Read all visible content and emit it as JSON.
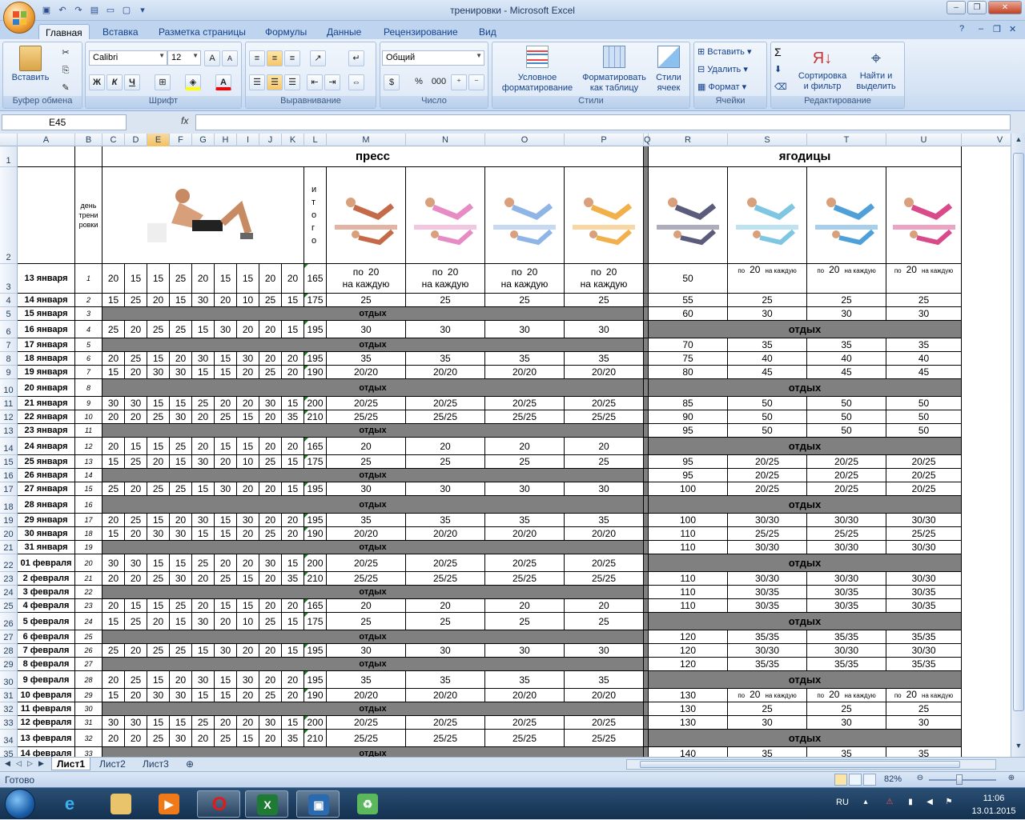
{
  "window": {
    "title": "тренировки - Microsoft Excel"
  },
  "ribbon": {
    "tabs": [
      "Главная",
      "Вставка",
      "Разметка страницы",
      "Формулы",
      "Данные",
      "Рецензирование",
      "Вид"
    ],
    "clipboard": {
      "paste": "Вставить",
      "group": "Буфер обмена"
    },
    "font": {
      "name": "Calibri",
      "size": "12",
      "bold": "Ж",
      "italic": "К",
      "underline": "Ч",
      "group": "Шрифт"
    },
    "alignment": {
      "group": "Выравнивание"
    },
    "number": {
      "format": "Общий",
      "percent": "%",
      "thousands": "000",
      "group": "Число"
    },
    "styles": {
      "cond_format": "Условное форматирование",
      "as_table": "Форматировать как таблицу",
      "cell_styles": "Стили ячеек",
      "group": "Стили"
    },
    "cells": {
      "insert": "Вставить",
      "delete": "Удалить",
      "format": "Формат",
      "group": "Ячейки"
    },
    "editing": {
      "sum": "Σ",
      "sort": "Сортировка и фильтр",
      "find": "Найти и выделить",
      "group": "Редактирование"
    }
  },
  "formula_bar": {
    "name_box": "E45",
    "fx": "fx",
    "formula": ""
  },
  "columns": [
    "A",
    "B",
    "C",
    "D",
    "E",
    "F",
    "G",
    "H",
    "I",
    "J",
    "K",
    "L",
    "M",
    "N",
    "O",
    "P",
    "Q",
    "R",
    "S",
    "T",
    "U",
    "V"
  ],
  "selected_column": "E",
  "sheet": {
    "header": {
      "press": "пресс",
      "glutes": "ягодицы",
      "day_label": "день трени ровки",
      "itogo": "и т о г о"
    },
    "rest": "отдых",
    "po": "по",
    "twenty": "20",
    "na_kazhduyu": "на каждую",
    "rows": [
      {
        "date": "13 января",
        "day": "1",
        "reps": [
          "20",
          "15",
          "15",
          "25",
          "20",
          "15",
          "15",
          "20",
          "20"
        ],
        "total": "165",
        "press": "mixed",
        "glutes": {
          "r": "50",
          "stu": "mixed"
        }
      },
      {
        "date": "14 января",
        "day": "2",
        "reps": [
          "15",
          "25",
          "20",
          "15",
          "30",
          "20",
          "10",
          "25",
          "15"
        ],
        "total": "175",
        "press": "25",
        "glutes": {
          "r": "55",
          "stu": "25"
        }
      },
      {
        "date": "15 января",
        "day": "3",
        "rest": true,
        "glutes": {
          "r": "60",
          "stu": "30"
        }
      },
      {
        "date": "16 января",
        "day": "4",
        "reps": [
          "25",
          "20",
          "25",
          "25",
          "15",
          "30",
          "20",
          "20",
          "15"
        ],
        "total": "195",
        "press": "30",
        "glutes": {
          "rest": true
        }
      },
      {
        "date": "17 января",
        "day": "5",
        "rest": true,
        "glutes": {
          "r": "70",
          "stu": "35"
        }
      },
      {
        "date": "18 января",
        "day": "6",
        "reps": [
          "20",
          "25",
          "15",
          "20",
          "30",
          "15",
          "30",
          "20",
          "20"
        ],
        "total": "195",
        "press": "35",
        "glutes": {
          "r": "75",
          "stu": "40"
        }
      },
      {
        "date": "19 января",
        "day": "7",
        "reps": [
          "15",
          "20",
          "30",
          "30",
          "15",
          "15",
          "20",
          "25",
          "20"
        ],
        "total": "190",
        "press": "20/20",
        "glutes": {
          "r": "80",
          "stu": "45"
        }
      },
      {
        "date": "20 января",
        "day": "8",
        "rest": true,
        "glutes": {
          "rest": true
        }
      },
      {
        "date": "21 января",
        "day": "9",
        "reps": [
          "30",
          "30",
          "15",
          "15",
          "25",
          "20",
          "20",
          "30",
          "15"
        ],
        "total": "200",
        "press": "20/25",
        "glutes": {
          "r": "85",
          "stu": "50"
        }
      },
      {
        "date": "22 января",
        "day": "10",
        "reps": [
          "20",
          "20",
          "25",
          "30",
          "20",
          "25",
          "15",
          "20",
          "35"
        ],
        "total": "210",
        "press": "25/25",
        "glutes": {
          "r": "90",
          "stu": "50"
        }
      },
      {
        "date": "23 января",
        "day": "11",
        "rest": true,
        "glutes": {
          "r": "95",
          "stu": "50"
        }
      },
      {
        "date": "24 января",
        "day": "12",
        "reps": [
          "20",
          "15",
          "15",
          "25",
          "20",
          "15",
          "15",
          "20",
          "20"
        ],
        "total": "165",
        "press": "20",
        "glutes": {
          "rest": true
        }
      },
      {
        "date": "25 января",
        "day": "13",
        "reps": [
          "15",
          "25",
          "20",
          "15",
          "30",
          "20",
          "10",
          "25",
          "15"
        ],
        "total": "175",
        "press": "25",
        "glutes": {
          "r": "95",
          "stu": "20/25"
        }
      },
      {
        "date": "26 января",
        "day": "14",
        "rest": true,
        "glutes": {
          "r": "95",
          "stu": "20/25"
        }
      },
      {
        "date": "27 января",
        "day": "15",
        "reps": [
          "25",
          "20",
          "25",
          "25",
          "15",
          "30",
          "20",
          "20",
          "15"
        ],
        "total": "195",
        "press": "30",
        "glutes": {
          "r": "100",
          "stu": "20/25"
        }
      },
      {
        "date": "28 января",
        "day": "16",
        "rest": true,
        "glutes": {
          "rest": true
        }
      },
      {
        "date": "29 января",
        "day": "17",
        "reps": [
          "20",
          "25",
          "15",
          "20",
          "30",
          "15",
          "30",
          "20",
          "20"
        ],
        "total": "195",
        "press": "35",
        "glutes": {
          "r": "100",
          "stu": "30/30"
        }
      },
      {
        "date": "30 января",
        "day": "18",
        "reps": [
          "15",
          "20",
          "30",
          "30",
          "15",
          "15",
          "20",
          "25",
          "20"
        ],
        "total": "190",
        "press": "20/20",
        "glutes": {
          "r": "110",
          "stu": "25/25"
        }
      },
      {
        "date": "31 января",
        "day": "19",
        "rest": true,
        "glutes": {
          "r": "110",
          "stu": "30/30"
        }
      },
      {
        "date": "01 февраля",
        "day": "20",
        "reps": [
          "30",
          "30",
          "15",
          "15",
          "25",
          "20",
          "20",
          "30",
          "15"
        ],
        "total": "200",
        "press": "20/25",
        "glutes": {
          "rest": true
        }
      },
      {
        "date": "2 февраля",
        "day": "21",
        "reps": [
          "20",
          "20",
          "25",
          "30",
          "20",
          "25",
          "15",
          "20",
          "35"
        ],
        "total": "210",
        "press": "25/25",
        "glutes": {
          "r": "110",
          "stu": "30/30"
        }
      },
      {
        "date": "3 февраля",
        "day": "22",
        "rest": true,
        "glutes": {
          "r": "110",
          "stu": "30/35"
        }
      },
      {
        "date": "4 февраля",
        "day": "23",
        "reps": [
          "20",
          "15",
          "15",
          "25",
          "20",
          "15",
          "15",
          "20",
          "20"
        ],
        "total": "165",
        "press": "20",
        "glutes": {
          "r": "110",
          "stu": "30/35"
        }
      },
      {
        "date": "5 февраля",
        "day": "24",
        "reps": [
          "15",
          "25",
          "20",
          "15",
          "30",
          "20",
          "10",
          "25",
          "15"
        ],
        "total": "175",
        "press": "25",
        "glutes": {
          "rest": true
        }
      },
      {
        "date": "6 февраля",
        "day": "25",
        "rest": true,
        "glutes": {
          "r": "120",
          "stu": "35/35"
        }
      },
      {
        "date": "7 февраля",
        "day": "26",
        "reps": [
          "25",
          "20",
          "25",
          "25",
          "15",
          "30",
          "20",
          "20",
          "15"
        ],
        "total": "195",
        "press": "30",
        "glutes": {
          "r": "120",
          "stu": "30/30"
        }
      },
      {
        "date": "8 февраля",
        "day": "27",
        "rest": true,
        "glutes": {
          "r": "120",
          "stu": "35/35"
        }
      },
      {
        "date": "9 февраля",
        "day": "28",
        "reps": [
          "20",
          "25",
          "15",
          "20",
          "30",
          "15",
          "30",
          "20",
          "20"
        ],
        "total": "195",
        "press": "35",
        "glutes": {
          "rest": true
        }
      },
      {
        "date": "10 февраля",
        "day": "29",
        "reps": [
          "15",
          "20",
          "30",
          "30",
          "15",
          "15",
          "20",
          "25",
          "20"
        ],
        "total": "190",
        "press": "20/20",
        "glutes": {
          "r": "130",
          "stu": "mixed"
        }
      },
      {
        "date": "11 февраля",
        "day": "30",
        "rest": true,
        "glutes": {
          "r": "130",
          "stu": "25"
        }
      },
      {
        "date": "12 февраля",
        "day": "31",
        "reps": [
          "30",
          "30",
          "15",
          "15",
          "25",
          "20",
          "20",
          "30",
          "15"
        ],
        "total": "200",
        "press": "20/25",
        "press_n": "20/25",
        "glutes": {
          "r": "130",
          "stu": "30"
        }
      },
      {
        "date": "13 февраля",
        "day": "32",
        "reps": [
          "20",
          "20",
          "25",
          "30",
          "20",
          "25",
          "15",
          "20",
          "35"
        ],
        "total": "210",
        "press": "25/25",
        "glutes": {
          "rest": true
        }
      },
      {
        "date": "14 февраля",
        "day": "33",
        "rest": true,
        "glutes": {
          "r": "140",
          "stu": "35"
        }
      }
    ]
  },
  "sheet_tabs": [
    "Лист1",
    "Лист2",
    "Лист3"
  ],
  "status": {
    "ready": "Готово",
    "zoom": "82%"
  },
  "taskbar": {
    "lang": "RU",
    "time": "11:06",
    "date": "13.01.2015"
  }
}
